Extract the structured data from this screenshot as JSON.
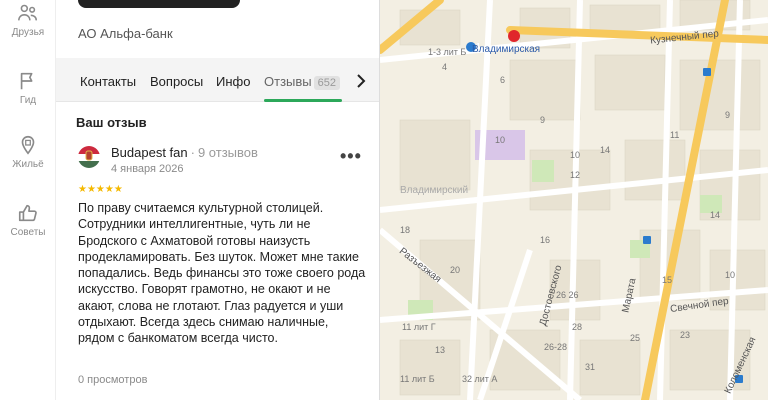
{
  "rail": {
    "items": [
      {
        "label": "Друзья",
        "icon": "friends-icon"
      },
      {
        "label": "Гид",
        "icon": "guide-flag-icon"
      },
      {
        "label": "Жильё",
        "icon": "housing-icon"
      },
      {
        "label": "Советы",
        "icon": "thumbs-up-icon"
      }
    ]
  },
  "panel": {
    "org_name": "АО Альфа-банк",
    "tabs": [
      {
        "label": "Контакты"
      },
      {
        "label": "Вопросы"
      },
      {
        "label": "Инфо"
      },
      {
        "label": "Отзывы",
        "badge": "652",
        "active": true
      }
    ],
    "section_title": "Ваш отзыв",
    "review": {
      "author": "Budapest fan",
      "review_count": "9 отзывов",
      "date": "4 января 2026",
      "rating": 5,
      "stars": "★★★★★",
      "text": "По праву считаемся культурной столицей. Сотрудники интеллигентные, чуть ли не Бродского с Ахматовой готовы наизусть продекламировать. Без шуток. Может мне такие попадались. Ведь финансы это тоже своего рода искусство. Говорят грамотно, не окают и не акают, слова не глотают. Глаз радуется и уши отдыхают. Всегда здесь снимаю наличные, рядом с банкоматом всегда чисто.",
      "views": "0 просмотров",
      "more_label": "•••"
    }
  },
  "map": {
    "labels": {
      "metro_name": "Владимирская",
      "metro_badge": "1",
      "kuznechny": "Кузнечный пер",
      "vladimirsky": "Владимирский",
      "razezzhaya": "Разъезжая",
      "dostoevskogo": "Достоевского",
      "marata": "Марата",
      "svechnoy": "Свечной пер",
      "kolomenskaya": "Коломенская",
      "b1": "1-3 лит Б",
      "b2": "4",
      "b3": "6",
      "b4": "9",
      "b5": "10",
      "b6": "10",
      "b7": "12",
      "b8": "14",
      "b9": "11",
      "b10": "18",
      "b11": "16",
      "b12": "20",
      "b13": "26 26",
      "b14": "28",
      "b15": "11 лит Г",
      "b16": "26-28",
      "b17": "25",
      "b18": "13",
      "b19": "15",
      "b20": "14",
      "b21": "10",
      "b22": "23",
      "b23": "9",
      "b24": "31",
      "b25": "32 лит А",
      "b26": "11 лит Б"
    },
    "colors": {
      "road_major": "#f7c95c",
      "road_minor": "#ffffff",
      "park": "#cfe8b8",
      "block": "#f3efe3",
      "building": "#e8e2d2",
      "highlight": "#d9c6e8"
    }
  },
  "colors": {
    "accent": "#2ca85a",
    "star": "#f5b900"
  }
}
